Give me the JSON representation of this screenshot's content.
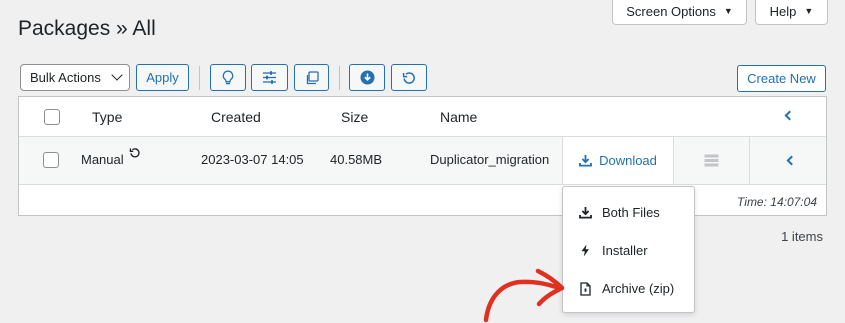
{
  "page": {
    "title": "Packages » All"
  },
  "top_tabs": {
    "screen_options": "Screen Options",
    "help": "Help"
  },
  "toolbar": {
    "bulk_actions": "Bulk Actions",
    "apply": "Apply",
    "create_new": "Create New",
    "icons": [
      "lightbulb-icon",
      "sliders-icon",
      "copy-icon",
      "download-circle-icon",
      "refresh-icon"
    ]
  },
  "table": {
    "headers": {
      "type": "Type",
      "created": "Created",
      "size": "Size",
      "name": "Name"
    },
    "rows": [
      {
        "type": "Manual",
        "created": "2023-03-07 14:05",
        "size": "40.58MB",
        "name": "Duplicator_migration",
        "download": "Download"
      }
    ],
    "footer_time": "Time: 14:07:04"
  },
  "item_count": "1 items",
  "download_menu": {
    "items": [
      {
        "label": "Both Files",
        "icon": "download-icon"
      },
      {
        "label": "Installer",
        "icon": "bolt-icon"
      },
      {
        "label": "Archive (zip)",
        "icon": "zip-file-icon"
      }
    ]
  },
  "annotation": {
    "arrow_color": "#e0301e"
  },
  "colors": {
    "accent": "#2271b1",
    "background": "#f0f0f1"
  }
}
